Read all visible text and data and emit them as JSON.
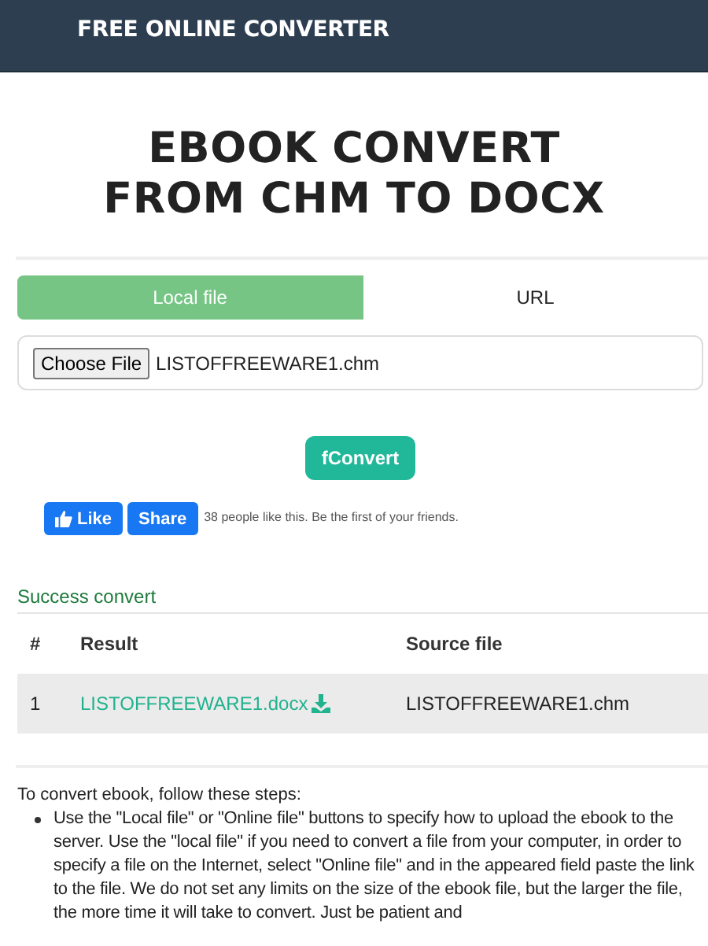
{
  "header": {
    "brand": "FREE ONLINE CONVERTER"
  },
  "title": "EBOOK CONVERT FROM CHM TO DOCX",
  "tabs": [
    {
      "label": "Local file",
      "selected": true
    },
    {
      "label": "URL",
      "selected": false
    }
  ],
  "file_input": {
    "button": "Choose File",
    "value": "LISTOFFREEWARE1.chm"
  },
  "convert_button": "fConvert",
  "social": {
    "like": "Like",
    "share": "Share",
    "text": "38 people like this. Be the first of your friends."
  },
  "results": {
    "heading": "Success convert",
    "columns": [
      "#",
      "Result",
      "Source file"
    ],
    "rows": [
      {
        "index": "1",
        "result": "LISTOFFREEWARE1.docx",
        "source": "LISTOFFREEWARE1.chm"
      }
    ]
  },
  "instructions": {
    "intro": "To convert ebook, follow these steps:",
    "steps": [
      "Use the \"Local file\" or \"Online file\" buttons to specify how to upload the ebook to the server. Use the \"local file\" if you need to convert a file from your computer, in order to specify a file on the Internet, select \"Online file\" and in the appeared field paste the link to the file. We do not set any limits on the size of the ebook file, but the larger the file, the more time it will take to convert. Just be patient and"
    ]
  }
}
